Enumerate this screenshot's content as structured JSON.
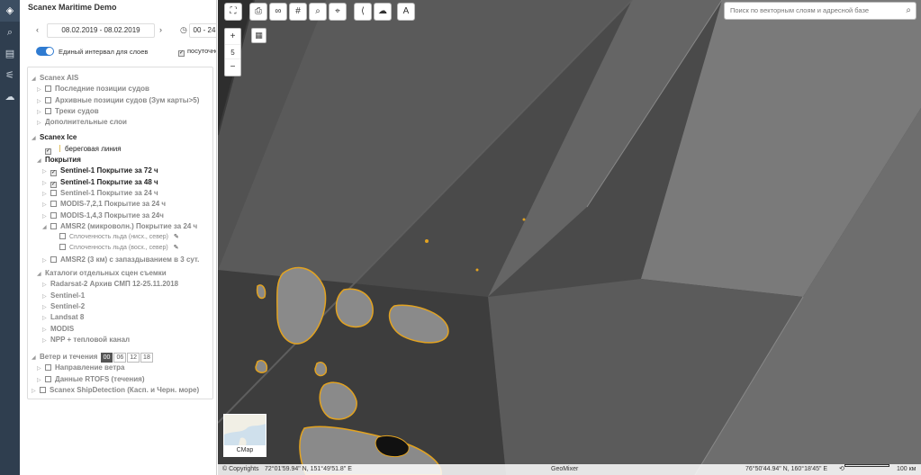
{
  "app": {
    "title": "Scanex Maritime Demo"
  },
  "sidebar_icons": [
    "layers-icon",
    "search-tool-icon",
    "document-icon",
    "tree-icon",
    "cloud-icon"
  ],
  "date": {
    "range": "08.02.2019 - 08.02.2019",
    "hours": "00 - 24"
  },
  "interval": {
    "label": "Единый интервал для слоев",
    "hourly_label": "посуточно"
  },
  "groups": {
    "ais": "Scanex AIS",
    "ais_items": [
      "Последние позиции судов",
      "Архивные позиции судов (Зум карты>5)",
      "Треки судов",
      "Дополнительные слои"
    ],
    "ice": "Scanex Ice",
    "coastline": "береговая линия",
    "coverage": "Покрытия",
    "coverage_items": [
      "Sentinel-1 Покрытие за 72 ч",
      "Sentinel-1 Покрытие за 48 ч",
      "Sentinel-1 Покрытие за 24 ч",
      "MODIS-7,2,1 Покрытие за 24 ч",
      "MODIS-1,4,3 Покрытие за 24ч",
      "AMSR2 (микроволн.) Покрытие за 24 ч"
    ],
    "amsr_sub": [
      "Сплоченность льда (нисх., север)",
      "Сплоченность льда (восх., север)"
    ],
    "amsr3": "AMSR2 (3 км) с запаздыванием в 3 сут.",
    "catalogs": "Каталоги отдельных сцен съемки",
    "catalog_items": [
      "Radarsat-2 Архив СМП 12-25.11.2018",
      "Sentinel-1",
      "Sentinel-2",
      "Landsat 8",
      "MODIS",
      "NPP + тепловой канал"
    ],
    "wind": "Ветер и течения",
    "wind_hours": [
      "00",
      "06",
      "12",
      "18"
    ],
    "wind_items": [
      "Направление ветра",
      "Данные RTOFS (течения)"
    ],
    "ship": "Scanex ShipDetection (Касп. и Черн. море)"
  },
  "toolbar": {
    "icons": [
      "fullscreen-icon",
      "print-icon",
      "link-icon",
      "grid-icon",
      "area-search-icon",
      "pin-icon",
      "share-icon",
      "cloud-icon",
      "text-tool-icon"
    ]
  },
  "search": {
    "placeholder": "Поиск по векторным слоям и адресной базе"
  },
  "zoom": {
    "plus": "+",
    "level": "5",
    "minus": "−"
  },
  "minimap": {
    "label": "СМар"
  },
  "status": {
    "copyright": "© Copyrights",
    "coord_left": "72°01'59.94\" N, 151°49'51.8\" E",
    "brand": "GeoMixer",
    "coord_right": "76°50'44.94\" N, 160°18'45\" E",
    "scale": "100 км"
  },
  "colors": {
    "accent": "#2f7bd1",
    "ice_outline": "#e3a320",
    "sidebar": "#2f3e4f"
  }
}
